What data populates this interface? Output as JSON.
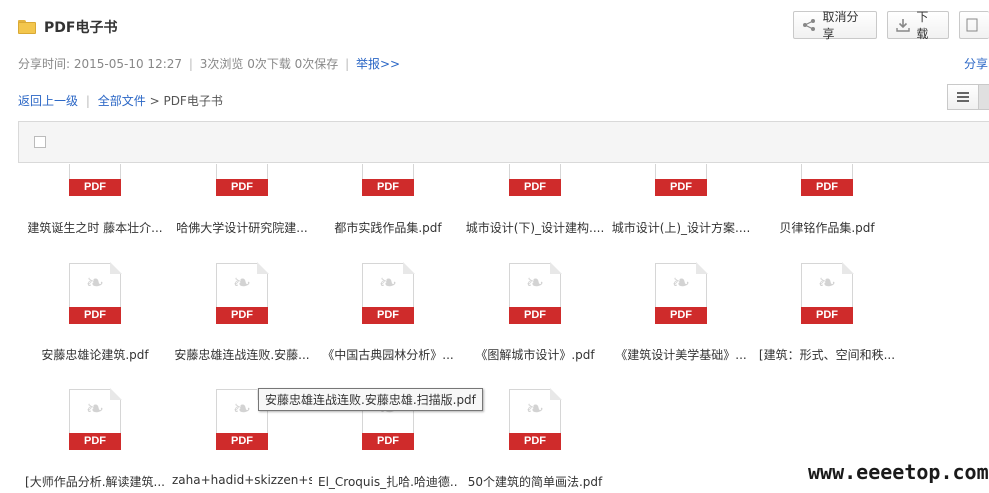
{
  "header": {
    "title": "PDF电子书",
    "buttons": {
      "cancel_share": "取消分享",
      "download": "下载"
    }
  },
  "meta": {
    "share_time_label": "分享时间:",
    "share_time": "2015-05-10 12:27",
    "views": "3次浏览",
    "downloads": "0次下载",
    "saves": "0次保存",
    "report": "举报>>",
    "share_right": "分享"
  },
  "breadcrumb": {
    "back": "返回上一级",
    "all_files": "全部文件",
    "sep": ">",
    "current": "PDF电子书"
  },
  "pdf_label": "PDF",
  "files": [
    {
      "name": "建筑诞生之时 藤本壮介..."
    },
    {
      "name": "哈佛大学设计研究院建..."
    },
    {
      "name": "都市实践作品集.pdf"
    },
    {
      "name": "城市设计(下)_设计建构...."
    },
    {
      "name": "城市设计(上)_设计方案...."
    },
    {
      "name": "贝律铭作品集.pdf"
    },
    {
      "name": "安藤忠雄论建筑.pdf"
    },
    {
      "name": "安藤忠雄连战连败.安藤..."
    },
    {
      "name": "《中国古典园林分析》..."
    },
    {
      "name": "《图解城市设计》.pdf"
    },
    {
      "name": "《建筑设计美学基础》..."
    },
    {
      "name": "[建筑：形式、空间和秩..."
    },
    {
      "name": "[大师作品分析.解读建筑..."
    },
    {
      "name": "zaha+hadid+skizzen+sk..."
    },
    {
      "name": "El_Croquis_扎哈.哈迪德..."
    },
    {
      "name": "50个建筑的简单画法.pdf"
    }
  ],
  "tooltip": "安藤忠雄连战连败.安藤忠雄.扫描版.pdf",
  "watermark": "www.eeeetop.com",
  "colors": {
    "link": "#2b67c6",
    "pdf_red": "#cf2b2b",
    "folder": "#f3c64d"
  }
}
